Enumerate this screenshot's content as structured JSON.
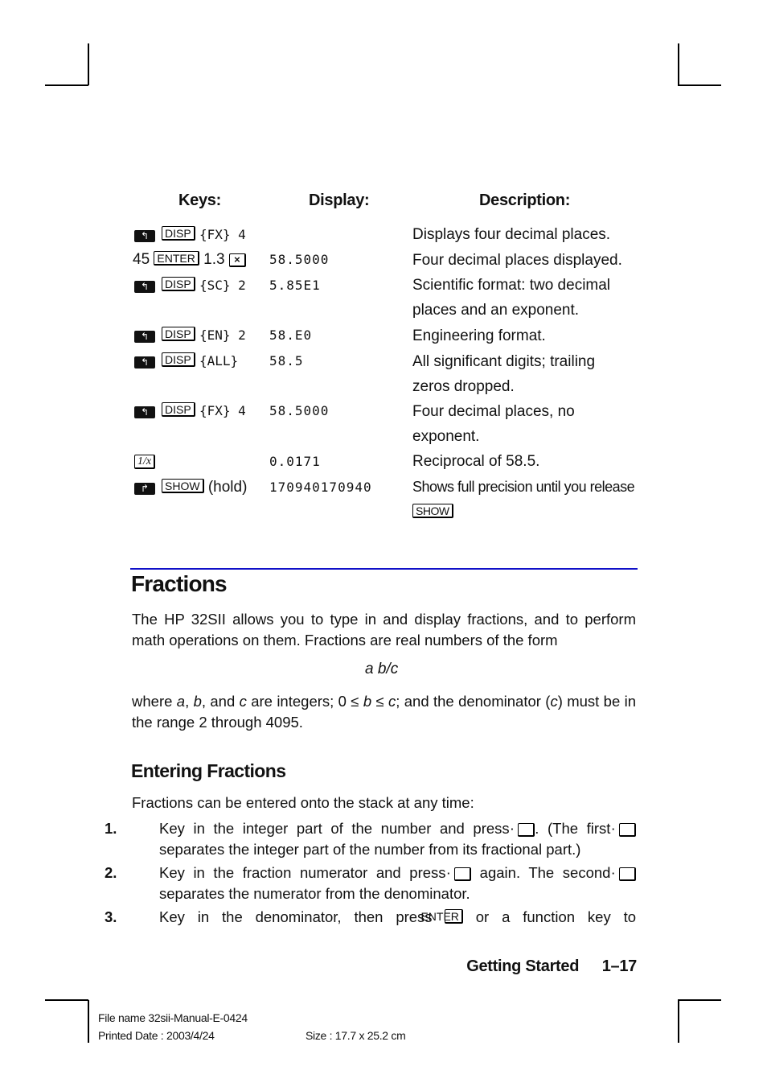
{
  "table": {
    "headers": {
      "keys": "Keys:",
      "display": "Display:",
      "description": "Description:"
    },
    "rows": [
      {
        "prefix_icon": "left-shift-key",
        "key1": "DISP",
        "soft": "{FX} 4",
        "display": "",
        "desc": [
          "Displays four decimal places."
        ]
      },
      {
        "lead": "45",
        "key1": "ENTER",
        "mid": "1.3",
        "key2": "×",
        "display": "58.5000",
        "desc": [
          "Four decimal places displayed."
        ]
      },
      {
        "prefix_icon": "left-shift-key",
        "key1": "DISP",
        "soft": "{SC} 2",
        "display": "5.85E1",
        "desc": [
          "Scientific format: two decimal",
          "places and an exponent."
        ]
      },
      {
        "prefix_icon": "left-shift-key",
        "key1": "DISP",
        "soft": "{EN} 2",
        "display": "58.E0",
        "desc": [
          "Engineering format."
        ]
      },
      {
        "prefix_icon": "left-shift-key",
        "key1": "DISP",
        "soft": "{ALL}",
        "display": "58.5",
        "desc": [
          "All significant digits; trailing",
          "zeros dropped."
        ]
      },
      {
        "prefix_icon": "left-shift-key",
        "key1": "DISP",
        "soft": "{FX} 4",
        "display": "58.5000",
        "desc": [
          "Four decimal places, no",
          "exponent."
        ]
      },
      {
        "key1": "1/x",
        "display": "0.0171",
        "desc": [
          "Reciprocal of 58.5."
        ]
      },
      {
        "prefix_icon": "right-shift-key",
        "key1": "SHOW",
        "mid": "(hold)",
        "display": "170940170940",
        "desc": [
          "Shows full precision until you release"
        ],
        "desc_key": "SHOW"
      }
    ]
  },
  "section": {
    "title": "Fractions",
    "intro": "The HP 32SII allows you to type in and display fractions, and to perform math operations on them. Fractions are real numbers of the form",
    "formula": "a b/c",
    "where": {
      "p1": "where ",
      "a": "a",
      "p2": ", ",
      "b": "b",
      "p3": ", and ",
      "c": "c",
      "p4": " are integers; 0 ≤ ",
      "b2": "b",
      "p5": " ≤ ",
      "c2": "c",
      "p6": "; and the denominator (",
      "c3": "c",
      "p7": ") must be in the range 2 through 4095."
    }
  },
  "subsection": {
    "title": "Entering Fractions",
    "lead": "Fractions can be entered onto the stack at any time:",
    "steps": [
      {
        "num": "1.",
        "a": "Key in the integer part of the number and press ",
        "b": ". (The first ",
        "c": " separates the integer part of the number from its fractional part.)"
      },
      {
        "num": "2.",
        "a": "Key in the fraction numerator and press ",
        "b": " again. The second ",
        "c": " separates the numerator from the denominator."
      },
      {
        "num": "3.",
        "a": "Key in the denominator, then press ",
        "key": "ENTER",
        "b": " or a function key to"
      }
    ]
  },
  "footer": {
    "running_head": "Getting Started",
    "page": "1–17",
    "file_name": "File name 32sii-Manual-E-0424",
    "printed_date": "Printed Date : 2003/4/24",
    "size": "Size : 17.7 x 25.2 cm"
  },
  "colors": {
    "section_rule": "#1010c8"
  }
}
